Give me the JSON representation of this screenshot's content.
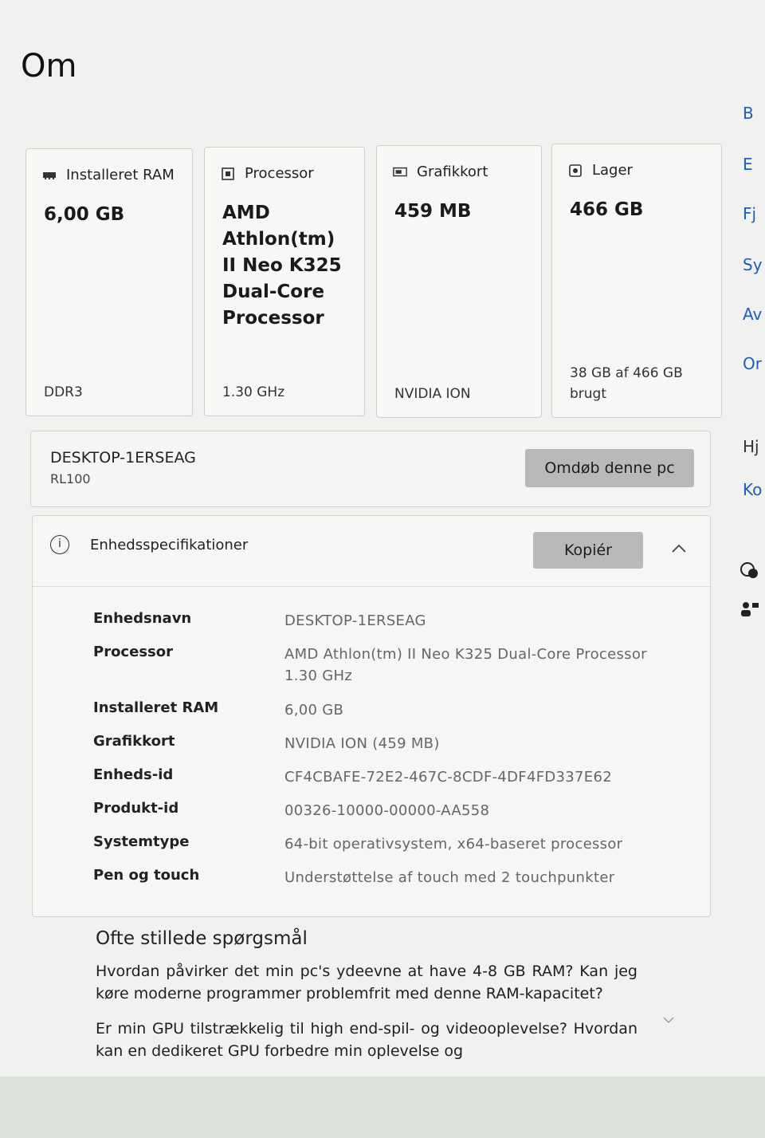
{
  "page": {
    "title": "Om"
  },
  "cards": [
    {
      "icon": "ram-icon",
      "label": "Installeret RAM",
      "value": "6,00 GB",
      "footer": "DDR3"
    },
    {
      "icon": "processor-icon",
      "label": "Processor",
      "value": "AMD Athlon(tm) II Neo K325 Dual-Core Processor",
      "footer": "1.30 GHz"
    },
    {
      "icon": "graphics-card-icon",
      "label": "Grafikkort",
      "value": "459 MB",
      "footer": "NVIDIA ION"
    },
    {
      "icon": "storage-icon",
      "label": "Lager",
      "value": "466 GB",
      "footer": "38 GB af 466 GB brugt"
    }
  ],
  "device": {
    "name": "DESKTOP-1ERSEAG",
    "model": "RL100",
    "rename_label": "Omdøb denne pc"
  },
  "specs": {
    "title": "Enhedsspecifikationer",
    "copy_label": "Kopiér",
    "rows": [
      {
        "label": "Enhedsnavn",
        "value": "DESKTOP-1ERSEAG"
      },
      {
        "label": "Processor",
        "value": "AMD Athlon(tm) II Neo K325 Dual-Core Processor 1.30 GHz"
      },
      {
        "label": "Installeret RAM",
        "value": "6,00 GB"
      },
      {
        "label": "Grafikkort",
        "value": "NVIDIA ION (459 MB)"
      },
      {
        "label": "Enheds-id",
        "value": "CF4CBAFE-72E2-467C-8CDF-4DF4FD337E62"
      },
      {
        "label": "Produkt-id",
        "value": "00326-10000-00000-AA558"
      },
      {
        "label": "Systemtype",
        "value": "64-bit operativsystem, x64-baseret processor"
      },
      {
        "label": "Pen og touch",
        "value": "Understøttelse af touch med 2 touchpunkter"
      }
    ]
  },
  "faq": {
    "title": "Ofte stillede spørgsmål",
    "questions": [
      "Hvordan påvirker det min pc's ydeevne at have 4-8 GB RAM? Kan jeg køre moderne programmer problemfrit med denne RAM-kapacitet?",
      "Er min GPU tilstrækkelig til high end-spil- og videooplevelse? Hvordan kan en dedikeret GPU forbedre min oplevelse og"
    ]
  },
  "sidebar": {
    "links": [
      "B",
      "E",
      "Fj",
      "Sy",
      "Av",
      "Or"
    ],
    "help": [
      "Hj",
      "Ko"
    ]
  },
  "colors": {
    "accent": "#1b5fb8",
    "button": "#b9bab8",
    "panel": "#f6f6f4"
  }
}
